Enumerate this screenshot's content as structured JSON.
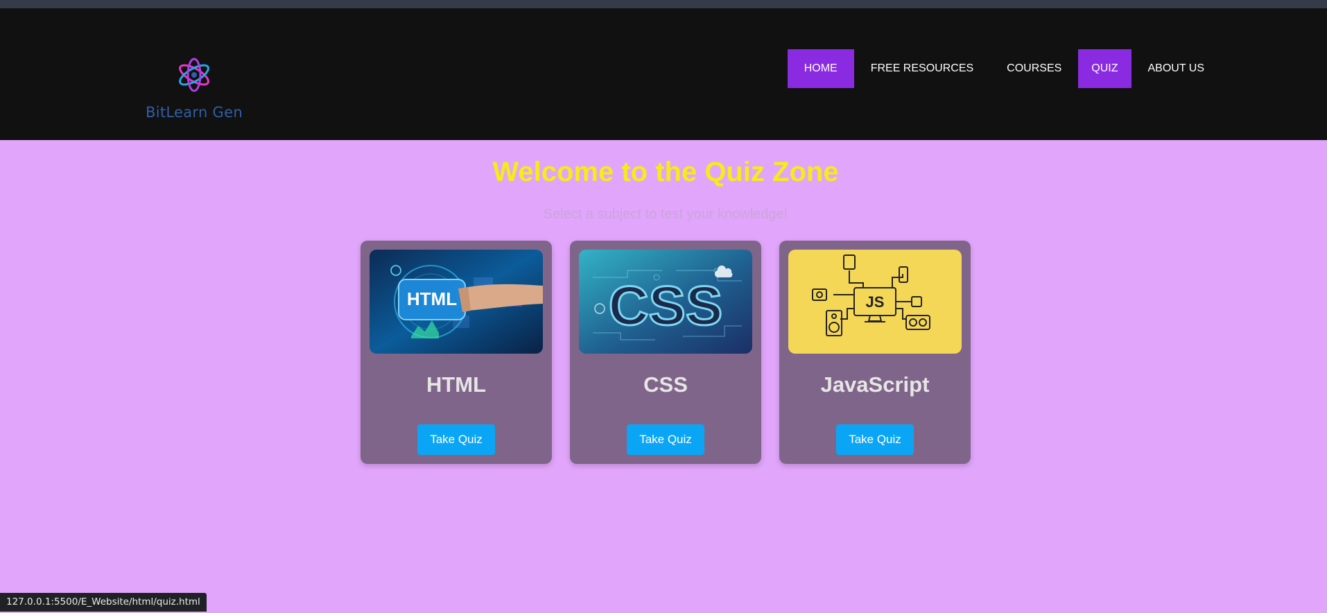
{
  "brand": {
    "name": "BitLearn Gen",
    "icon": "atom-logo-icon"
  },
  "nav": {
    "items": [
      {
        "label": "HOME",
        "active": true
      },
      {
        "label": "FREE RESOURCES",
        "active": false
      },
      {
        "label": "COURSES",
        "active": false
      },
      {
        "label": "QUIZ",
        "active": true
      },
      {
        "label": "ABOUT US",
        "active": false
      }
    ]
  },
  "hero": {
    "title": "Welcome to the Quiz Zone",
    "subtitle": "Select a subject to test your knowledge!"
  },
  "cards": [
    {
      "title": "HTML",
      "button": "Take Quiz",
      "image_text": "HTML"
    },
    {
      "title": "CSS",
      "button": "Take Quiz",
      "image_text": "CSS"
    },
    {
      "title": "JavaScript",
      "button": "Take Quiz",
      "image_text": "JS"
    }
  ],
  "status_bar": {
    "url": "127.0.0.1:5500/E_Website/html/quiz.html"
  },
  "colors": {
    "page_bg": "#e1a5fb",
    "header_bg": "#111111",
    "nav_active": "#8a2be2",
    "title": "#f5ec1a",
    "card_bg": "#80658a",
    "button": "#0aa6f5"
  }
}
